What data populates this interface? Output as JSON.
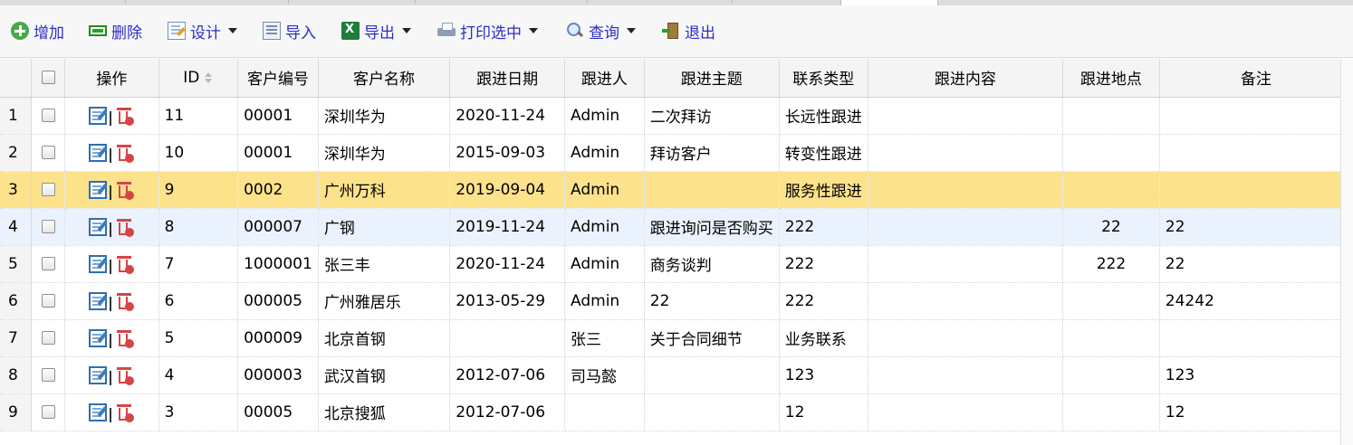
{
  "toolbar": {
    "add": "增加",
    "delete": "删除",
    "design": "设计",
    "import": "导入",
    "export": "导出",
    "print": "打印选中",
    "query": "查询",
    "exit": "退出"
  },
  "columns": {
    "ops": "操作",
    "id": "ID",
    "cust_no": "客户编号",
    "cust_name": "客户名称",
    "date": "跟进日期",
    "person": "跟进人",
    "topic": "跟进主题",
    "contact_type": "联系类型",
    "content": "跟进内容",
    "location": "跟进地点",
    "remark": "备注"
  },
  "rows": [
    {
      "rn": "1",
      "id": "11",
      "cust_no": "00001",
      "cust_name": "深圳华为",
      "date": "2020-11-24",
      "person": "Admin",
      "topic": "二次拜访",
      "contact_type": "长远性跟进",
      "content": "",
      "location": "",
      "remark": ""
    },
    {
      "rn": "2",
      "id": "10",
      "cust_no": "00001",
      "cust_name": "深圳华为",
      "date": "2015-09-03",
      "person": "Admin",
      "topic": "拜访客户",
      "contact_type": "转变性跟进",
      "content": "",
      "location": "",
      "remark": ""
    },
    {
      "rn": "3",
      "id": "9",
      "cust_no": "0002",
      "cust_name": "广州万科",
      "date": "2019-09-04",
      "person": "Admin",
      "topic": "",
      "contact_type": "服务性跟进",
      "content": "",
      "location": "",
      "remark": ""
    },
    {
      "rn": "4",
      "id": "8",
      "cust_no": "000007",
      "cust_name": "广钢",
      "date": "2019-11-24",
      "person": "Admin",
      "topic": "跟进询问是否购买",
      "contact_type": "222",
      "content": "",
      "location": "22",
      "remark": "22"
    },
    {
      "rn": "5",
      "id": "7",
      "cust_no": "1000001",
      "cust_name": "张三丰",
      "date": "2020-11-24",
      "person": "Admin",
      "topic": "商务谈判",
      "contact_type": "222",
      "content": "",
      "location": "222",
      "remark": "22"
    },
    {
      "rn": "6",
      "id": "6",
      "cust_no": "000005",
      "cust_name": "广州雅居乐",
      "date": "2013-05-29",
      "person": "Admin",
      "topic": "22",
      "contact_type": "222",
      "content": "",
      "location": "",
      "remark": "24242"
    },
    {
      "rn": "7",
      "id": "5",
      "cust_no": "000009",
      "cust_name": "北京首钢",
      "date": "",
      "person": "张三",
      "topic": "关于合同细节",
      "contact_type": "业务联系",
      "content": "",
      "location": "",
      "remark": ""
    },
    {
      "rn": "8",
      "id": "4",
      "cust_no": "000003",
      "cust_name": "武汉首钢",
      "date": "2012-07-06",
      "person": "司马懿",
      "topic": "",
      "contact_type": "123",
      "content": "",
      "location": "",
      "remark": "123"
    },
    {
      "rn": "9",
      "id": "3",
      "cust_no": "00005",
      "cust_name": "北京搜狐",
      "date": "2012-07-06",
      "person": "",
      "topic": "",
      "contact_type": "12",
      "content": "",
      "location": "",
      "remark": "12"
    }
  ],
  "selected_row": "3",
  "hover_row": "4"
}
